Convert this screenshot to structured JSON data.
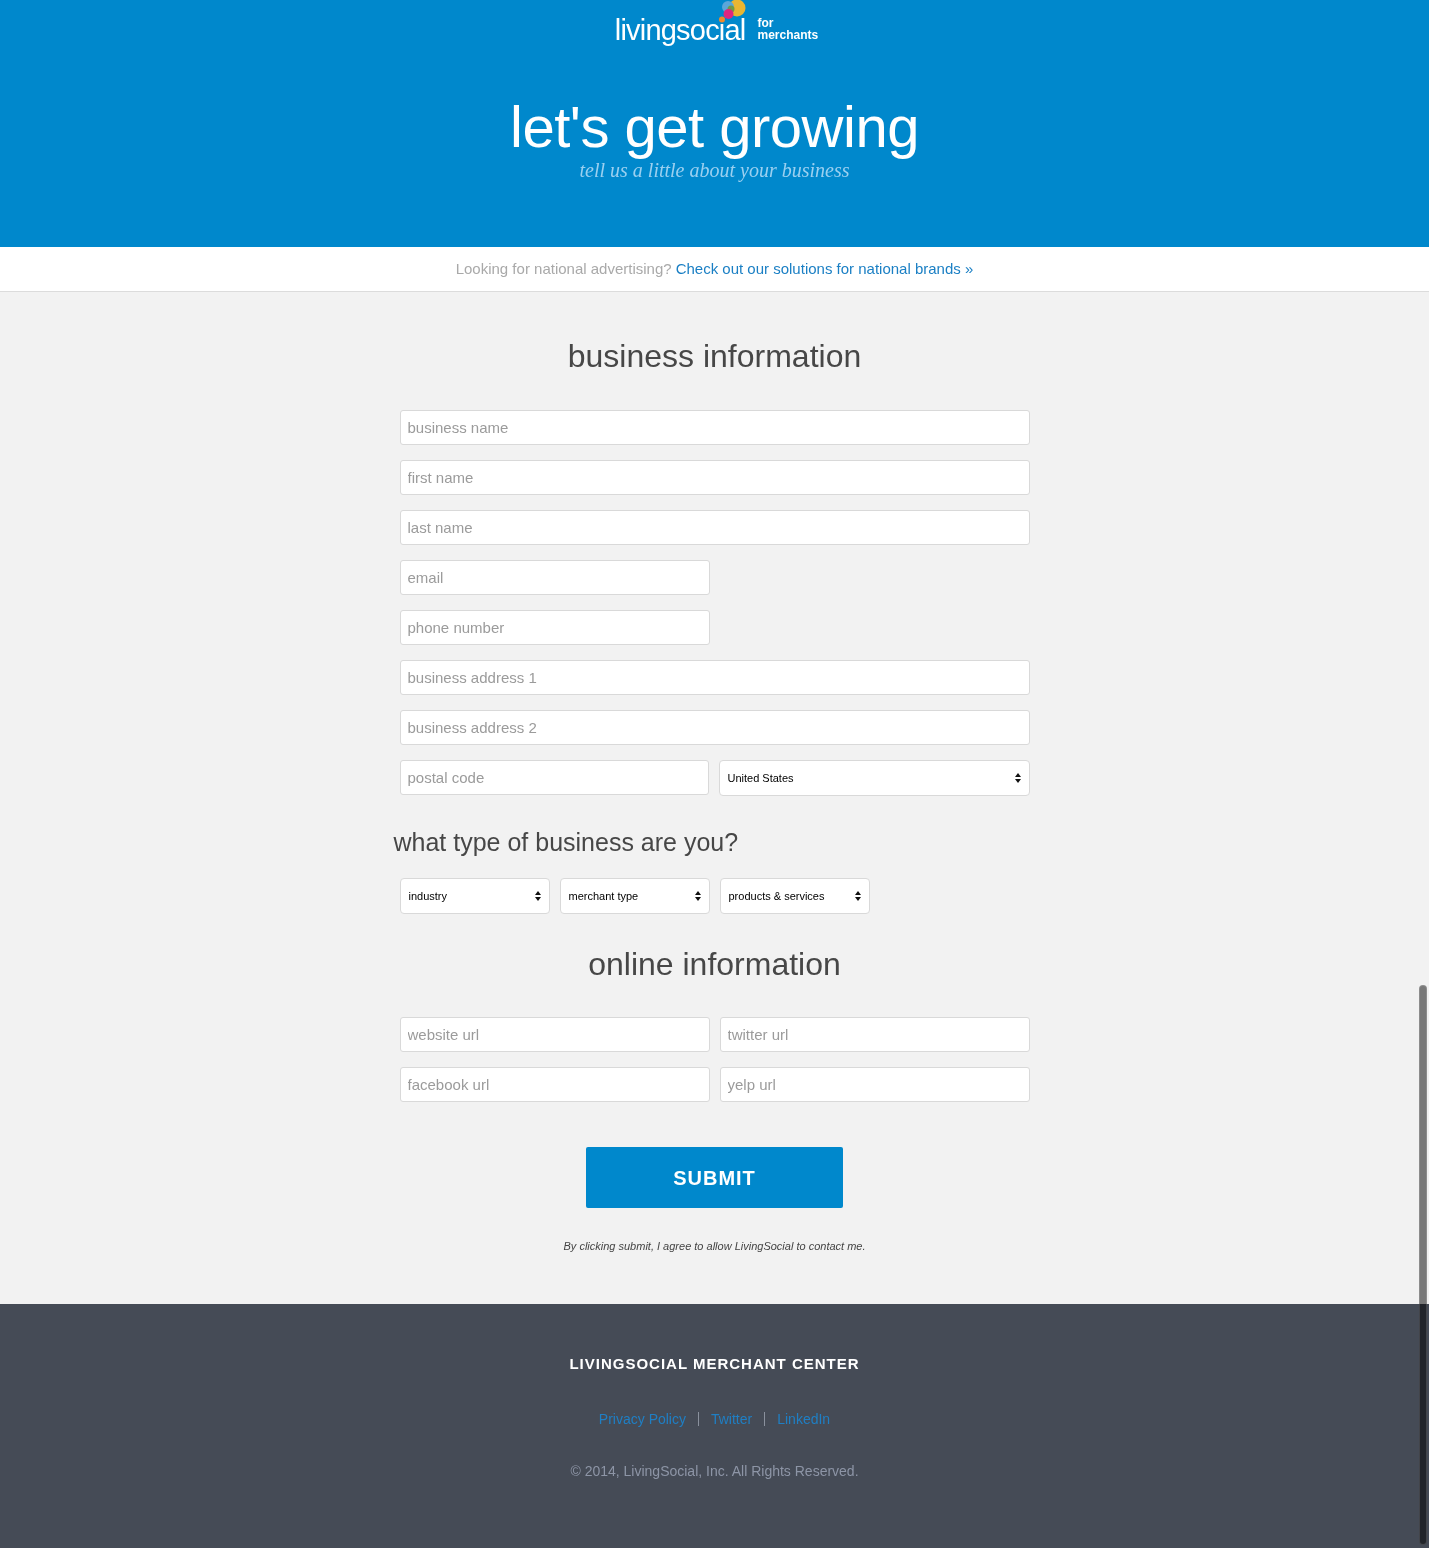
{
  "header": {
    "logo": {
      "wordmark": "livingsocial",
      "tagline_top": "for",
      "tagline_bottom": "merchants"
    },
    "title": "let's get growing",
    "subtitle": "tell us a little about your business"
  },
  "banner": {
    "text": "Looking for national advertising?",
    "link": "Check out our solutions for national brands »"
  },
  "business_information": {
    "heading": "business information",
    "rows": [
      {
        "fields": [
          {
            "kind": "text",
            "placeholder": "business name",
            "short": false
          }
        ]
      },
      {
        "fields": [
          {
            "kind": "text",
            "placeholder": "first name",
            "short": false
          }
        ]
      },
      {
        "fields": [
          {
            "kind": "text",
            "placeholder": "last name",
            "short": false
          }
        ]
      },
      {
        "fields": [
          {
            "kind": "text",
            "placeholder": "email",
            "short": true
          }
        ]
      },
      {
        "fields": [
          {
            "kind": "text",
            "placeholder": "phone number",
            "short": true
          }
        ]
      },
      {
        "fields": [
          {
            "kind": "text",
            "placeholder": "business address 1",
            "short": false
          }
        ]
      },
      {
        "fields": [
          {
            "kind": "text",
            "placeholder": "business address 2",
            "short": false
          }
        ]
      },
      {
        "fields": [
          {
            "kind": "text",
            "placeholder": "postal code"
          },
          {
            "kind": "select",
            "value": "United States"
          }
        ]
      }
    ]
  },
  "business_type": {
    "heading": "what type of business are you?",
    "selects": [
      {
        "value": "industry"
      },
      {
        "value": "merchant type"
      },
      {
        "value": "products & services"
      }
    ]
  },
  "online_information": {
    "heading": "online information",
    "rows": [
      {
        "fields": [
          {
            "kind": "text",
            "placeholder": "website url"
          },
          {
            "kind": "text",
            "placeholder": "twitter url"
          }
        ]
      },
      {
        "fields": [
          {
            "kind": "text",
            "placeholder": "facebook url"
          },
          {
            "kind": "text",
            "placeholder": "yelp url"
          }
        ]
      }
    ]
  },
  "submit": {
    "label": "SUBMIT",
    "note": "By clicking submit, I agree to allow LivingSocial to contact me."
  },
  "footer": {
    "title": "LIVINGSOCIAL MERCHANT CENTER",
    "links": [
      "Privacy Policy",
      "Twitter",
      "LinkedIn"
    ],
    "copyright": "© 2014, LivingSocial, Inc. All Rights Reserved."
  }
}
